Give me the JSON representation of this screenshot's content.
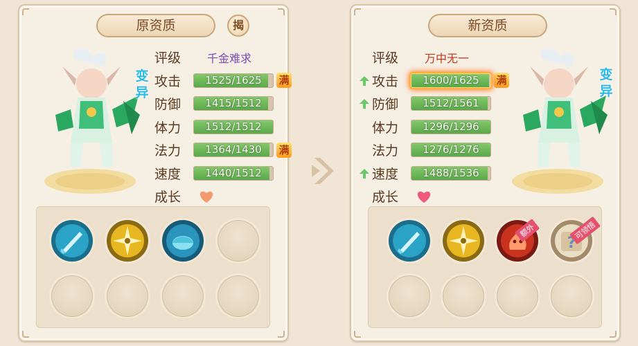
{
  "left_panel": {
    "title": "原资质",
    "reveal_button": "揭",
    "mutation_label": "变异",
    "grade": {
      "label": "评级",
      "value": "千金难求"
    },
    "stats": [
      {
        "label": "攻击",
        "value": "1525/1625",
        "current": 1525,
        "max": 1625,
        "maxed": true,
        "max_badge": "满"
      },
      {
        "label": "防御",
        "value": "1415/1512",
        "current": 1415,
        "max": 1512,
        "maxed": false
      },
      {
        "label": "体力",
        "value": "1512/1512",
        "current": 1512,
        "max": 1512,
        "maxed": false
      },
      {
        "label": "法力",
        "value": "1364/1430",
        "current": 1364,
        "max": 1430,
        "maxed": true,
        "max_badge": "满"
      },
      {
        "label": "速度",
        "value": "1440/1512",
        "current": 1440,
        "max": 1512,
        "maxed": false
      }
    ],
    "growth": {
      "label": "成长",
      "icon": "heart-orange-icon"
    },
    "skills": [
      "sword-skill-icon",
      "shuriken-skill-icon",
      "turtle-shell-skill-icon",
      "",
      "",
      "",
      "",
      ""
    ]
  },
  "right_panel": {
    "title": "新资质",
    "mutation_label": "变异",
    "grade": {
      "label": "评级",
      "value": "万中无一"
    },
    "stats": [
      {
        "label": "攻击",
        "value": "1600/1625",
        "current": 1600,
        "max": 1625,
        "maxed": true,
        "max_badge": "满",
        "improved": true,
        "highlight": true
      },
      {
        "label": "防御",
        "value": "1512/1561",
        "current": 1512,
        "max": 1561,
        "maxed": false,
        "improved": true
      },
      {
        "label": "体力",
        "value": "1296/1296",
        "current": 1296,
        "max": 1296,
        "maxed": false,
        "improved": false
      },
      {
        "label": "法力",
        "value": "1276/1276",
        "current": 1276,
        "max": 1276,
        "maxed": false,
        "improved": false
      },
      {
        "label": "速度",
        "value": "1488/1536",
        "current": 1488,
        "max": 1536,
        "maxed": false,
        "improved": true
      }
    ],
    "growth": {
      "label": "成长",
      "icon": "heart-pink-icon"
    },
    "skills": [
      {
        "icon": "sword-skill-icon"
      },
      {
        "icon": "shuriken-skill-icon"
      },
      {
        "icon": "fire-spirit-skill-icon",
        "tag": "额外"
      },
      {
        "icon": "scroll-question-skill-icon",
        "tag": "可领悟"
      },
      {
        "icon": ""
      },
      {
        "icon": ""
      },
      {
        "icon": ""
      },
      {
        "icon": ""
      }
    ]
  },
  "colors": {
    "bar_fill": "#6bb85a",
    "bar_track": "#d8c5b0",
    "mutation": "#2cb8e6",
    "arrow_up": "#6bc86a"
  }
}
